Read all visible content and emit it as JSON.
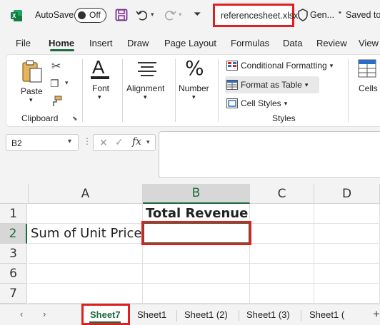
{
  "titlebar": {
    "autosave_label": "AutoSave",
    "autosave_state": "Off",
    "filename": "referencesheet.xlsx",
    "sensitivity": "Gen...",
    "saved_status": "Saved to"
  },
  "tabs": [
    "File",
    "Home",
    "Insert",
    "Draw",
    "Page Layout",
    "Formulas",
    "Data",
    "Review",
    "View"
  ],
  "active_tab": "Home",
  "ribbon": {
    "paste_label": "Paste",
    "clipboard_label": "Clipboard",
    "font_label": "Font",
    "alignment_label": "Alignment",
    "number_label": "Number",
    "conditional_formatting": "Conditional Formatting",
    "format_as_table": "Format as Table",
    "cell_styles": "Cell Styles",
    "styles_label": "Styles",
    "cells_label": "Cells"
  },
  "formula_bar": {
    "name_box": "B2",
    "fx": "fx",
    "formula": ""
  },
  "grid": {
    "columns": [
      "A",
      "B",
      "C",
      "D"
    ],
    "rows": [
      "1",
      "2",
      "3",
      "6",
      "7"
    ],
    "cells": {
      "B1": "Total Revenue",
      "A2": "Sum of Unit Price",
      "B2": ""
    },
    "selected_cell": "B2"
  },
  "sheets": {
    "active": "Sheet7",
    "tabs": [
      "Sheet1",
      "Sheet1 (2)",
      "Sheet1 (3)",
      "Sheet1 ("
    ]
  },
  "colors": {
    "accent": "#1d6b3f",
    "highlight": "#e02020"
  }
}
